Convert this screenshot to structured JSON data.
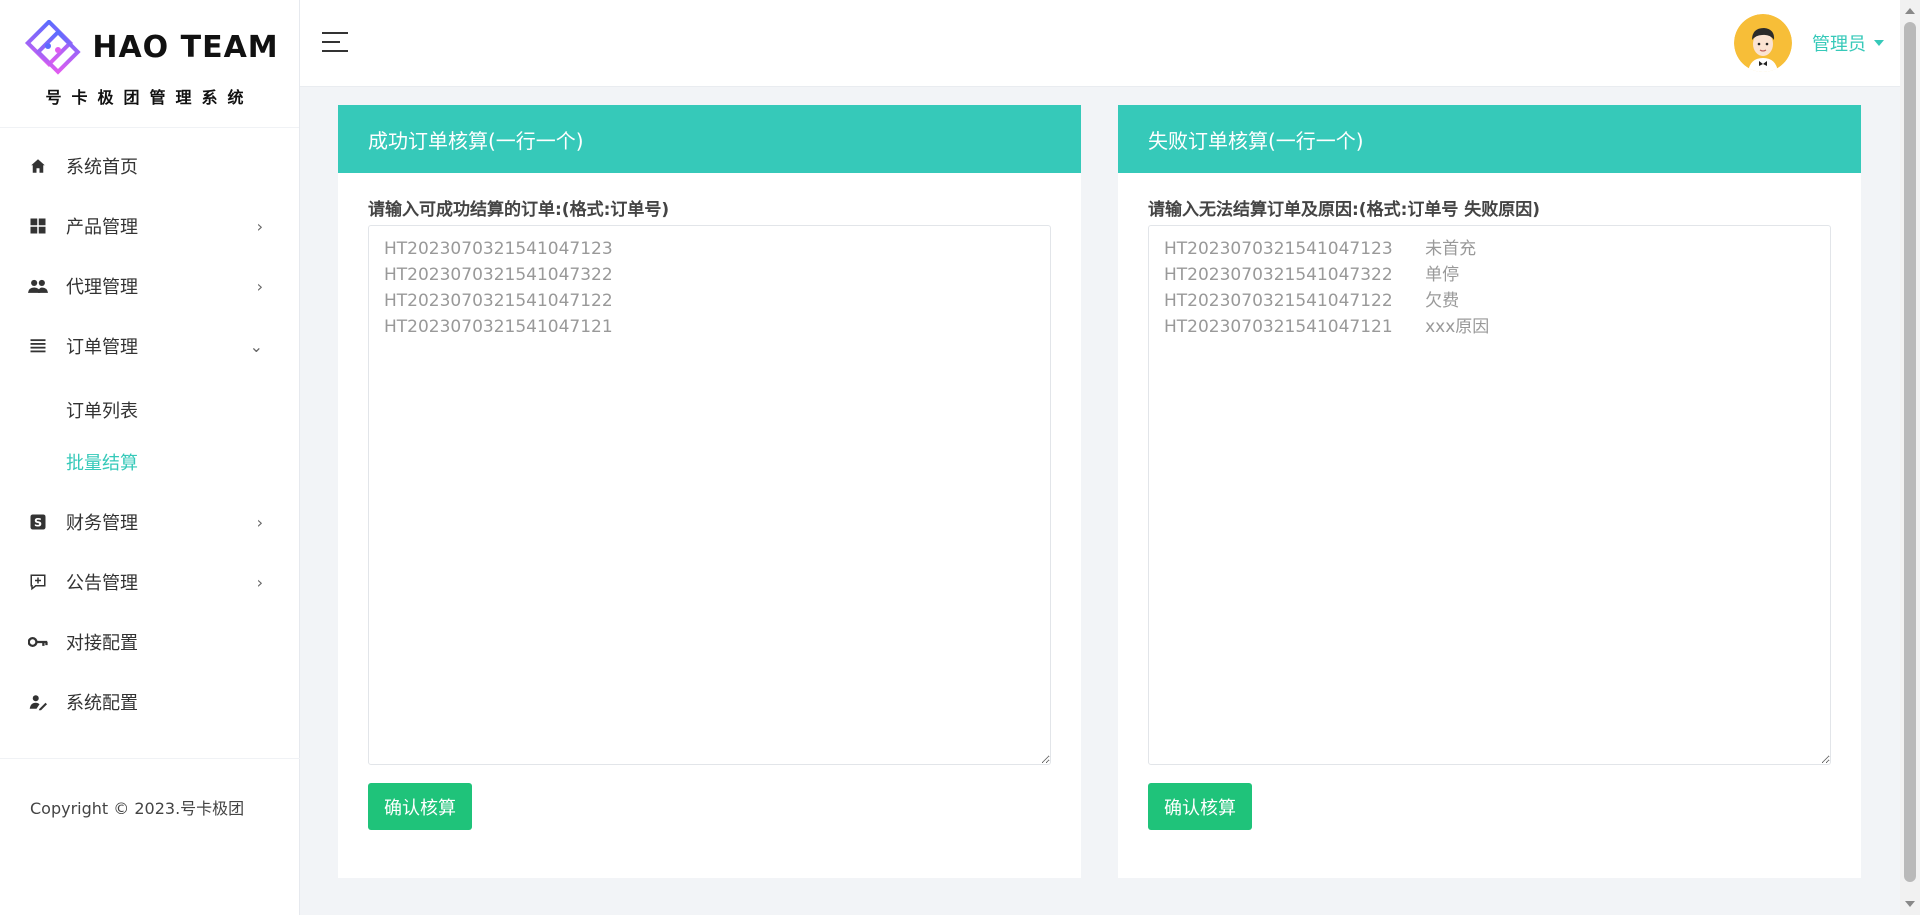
{
  "logo": {
    "title": "HAO TEAM",
    "subtitle": "号卡极团管理系统"
  },
  "sidebar": {
    "items": [
      {
        "label": "系统首页",
        "icon": "home-icon"
      },
      {
        "label": "产品管理",
        "icon": "grid-icon"
      },
      {
        "label": "代理管理",
        "icon": "people-icon"
      },
      {
        "label": "订单管理",
        "icon": "list-icon"
      },
      {
        "label": "财务管理",
        "icon": "dollar-icon"
      },
      {
        "label": "公告管理",
        "icon": "announce-icon"
      },
      {
        "label": "对接配置",
        "icon": "key-icon"
      },
      {
        "label": "系统配置",
        "icon": "user-edit-icon"
      }
    ],
    "order_sub": [
      {
        "label": "订单列表"
      },
      {
        "label": "批量结算"
      }
    ],
    "copyright": "Copyright © 2023.号卡极团"
  },
  "topbar": {
    "user_name": "管理员"
  },
  "success_card": {
    "title": "成功订单核算(一行一个)",
    "label": "请输入可成功结算的订单:(格式:订单号)",
    "placeholder": "HT2023070321541047123\nHT2023070321541047322\nHT2023070321541047122\nHT2023070321541047121",
    "button": "确认核算"
  },
  "fail_card": {
    "title": "失败订单核算(一行一个)",
    "label": "请输入无法结算订单及原因:(格式:订单号 失败原因)",
    "placeholder": "HT2023070321541047123      未首充\nHT2023070321541047322      单停\nHT2023070321541047122      欠费\nHT2023070321541047121      xxx原因",
    "button": "确认核算"
  },
  "colors": {
    "accent": "#36c9b9",
    "button": "#1fc37a",
    "background": "#f2f4f7"
  }
}
